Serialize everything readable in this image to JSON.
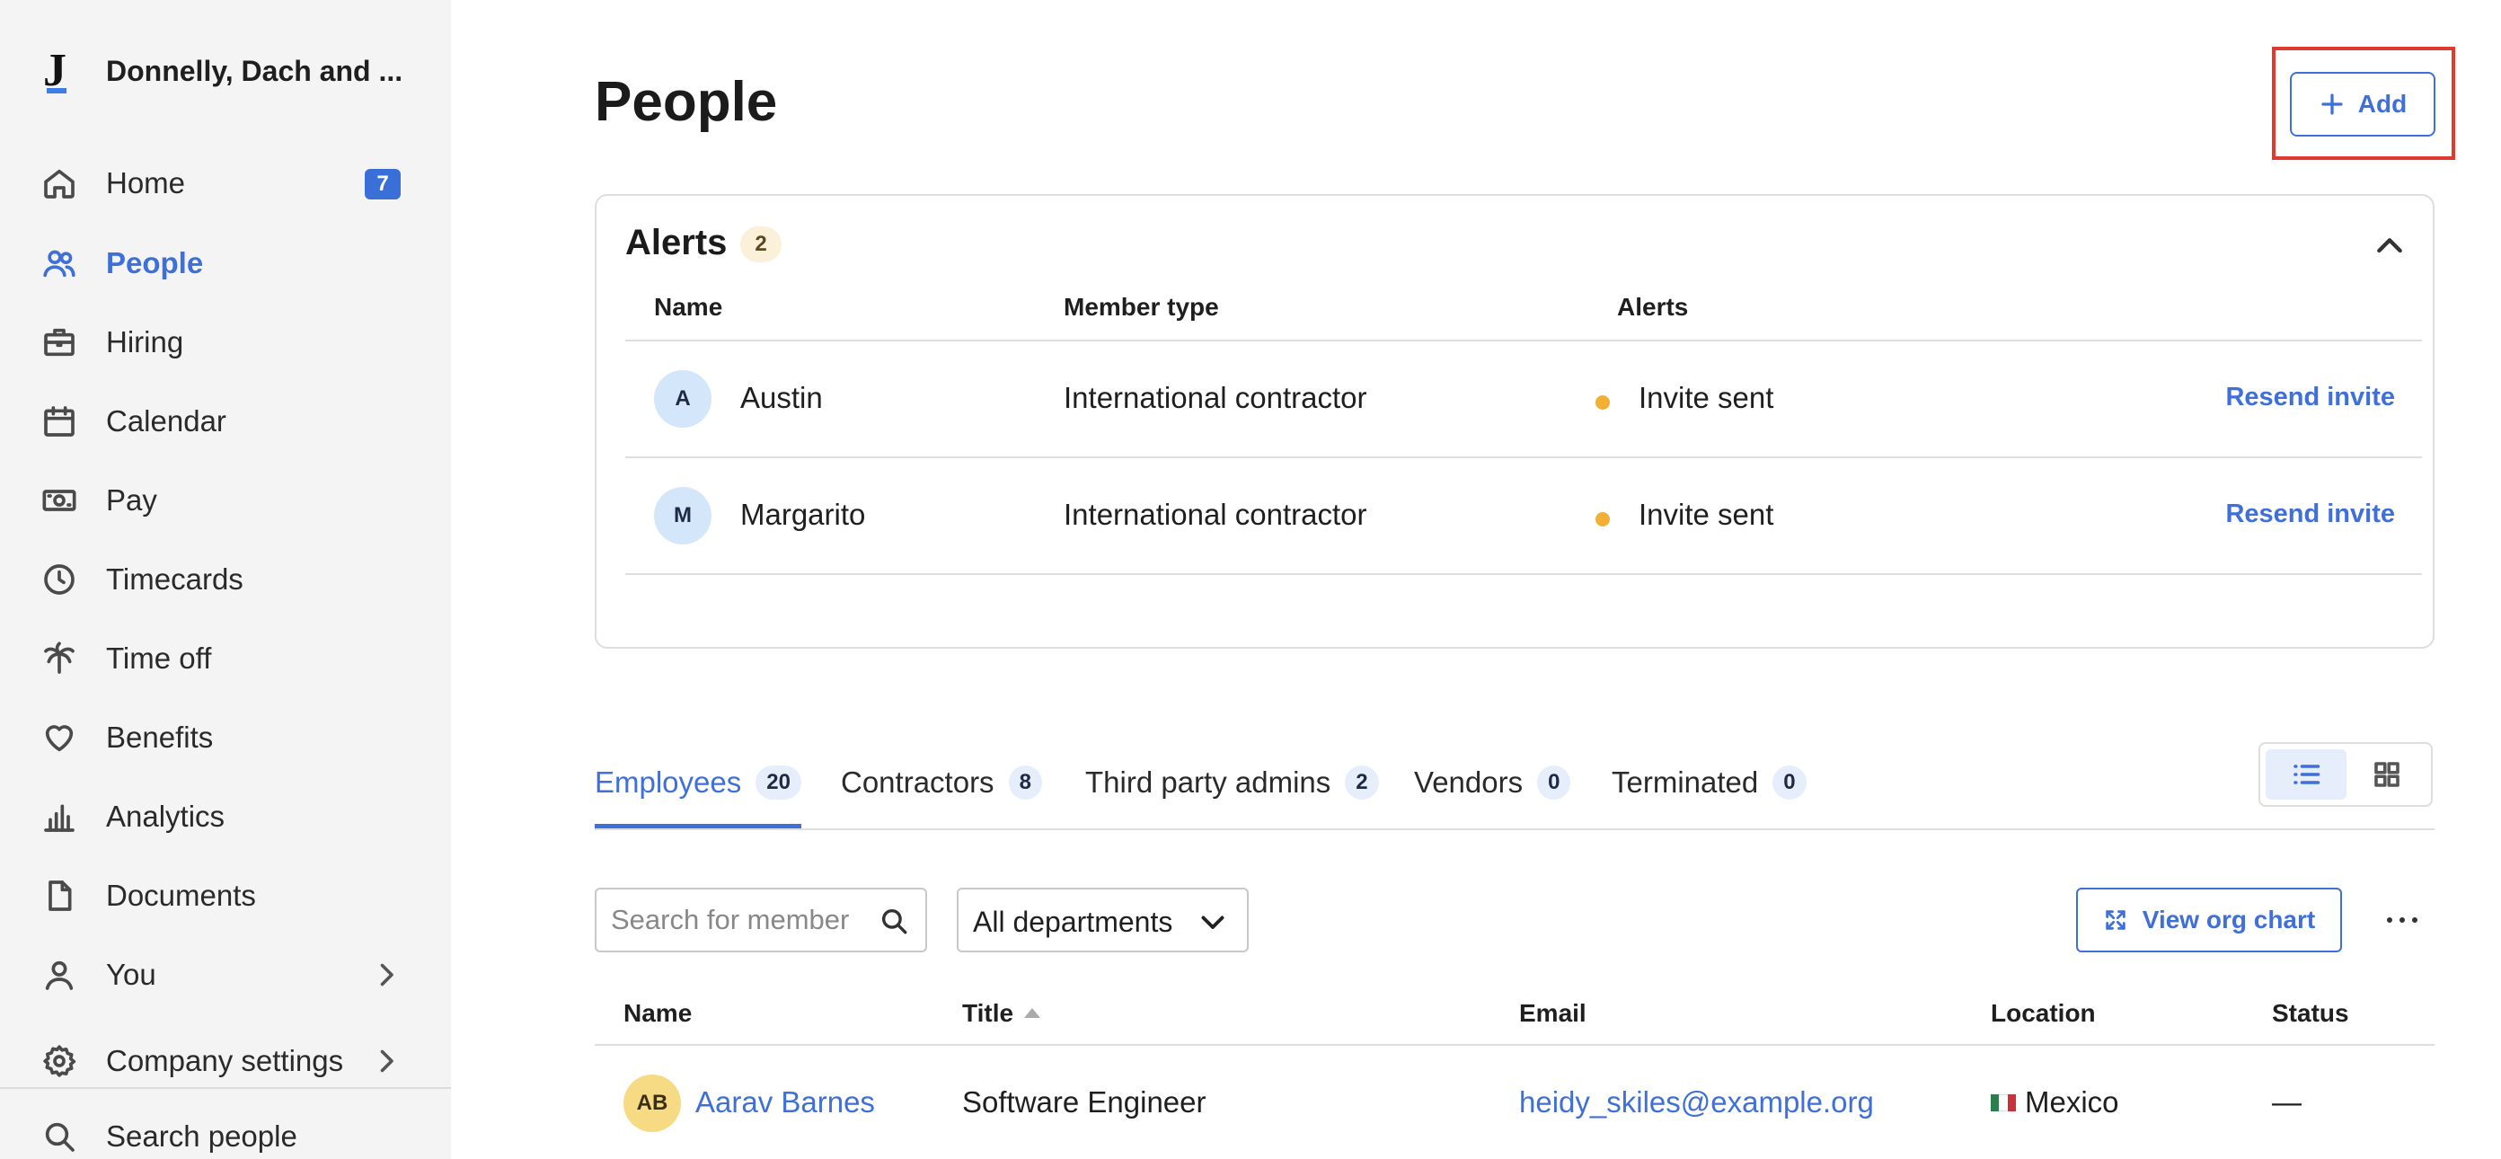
{
  "sidebar": {
    "brand": "Donnelly, Dach and ...",
    "brand_initial": "J",
    "items": [
      {
        "label": "Home",
        "badge": "7"
      },
      {
        "label": "People"
      },
      {
        "label": "Hiring"
      },
      {
        "label": "Calendar"
      },
      {
        "label": "Pay"
      },
      {
        "label": "Timecards"
      },
      {
        "label": "Time off"
      },
      {
        "label": "Benefits"
      },
      {
        "label": "Analytics"
      },
      {
        "label": "Documents"
      },
      {
        "label": "You"
      },
      {
        "label": "Company settings"
      },
      {
        "label": "Search people"
      }
    ]
  },
  "header": {
    "title": "People",
    "add_label": "Add"
  },
  "alerts": {
    "title": "Alerts",
    "count": "2",
    "columns": [
      "Name",
      "Member type",
      "Alerts"
    ],
    "rows": [
      {
        "initial": "A",
        "name": "Austin",
        "member_type": "International contractor",
        "status": "Invite sent",
        "action": "Resend invite"
      },
      {
        "initial": "M",
        "name": "Margarito",
        "member_type": "International contractor",
        "status": "Invite sent",
        "action": "Resend invite"
      }
    ]
  },
  "tabs": [
    {
      "label": "Employees",
      "count": "20"
    },
    {
      "label": "Contractors",
      "count": "8"
    },
    {
      "label": "Third party admins",
      "count": "2"
    },
    {
      "label": "Vendors",
      "count": "0"
    },
    {
      "label": "Terminated",
      "count": "0"
    }
  ],
  "filters": {
    "search_placeholder": "Search for member",
    "department_value": "All departments",
    "org_chart_label": "View org chart"
  },
  "table": {
    "columns": [
      "Name",
      "Title",
      "Email",
      "Location",
      "Status"
    ],
    "rows": [
      {
        "initials": "AB",
        "name": "Aarav Barnes",
        "title": "Software Engineer",
        "email": "heidy_skiles@example.org",
        "location": "Mexico",
        "status": "—"
      }
    ]
  },
  "colors": {
    "accent": "#3f6fd8",
    "highlight_border": "#e03a2f",
    "alert_dot": "#f2b036"
  }
}
